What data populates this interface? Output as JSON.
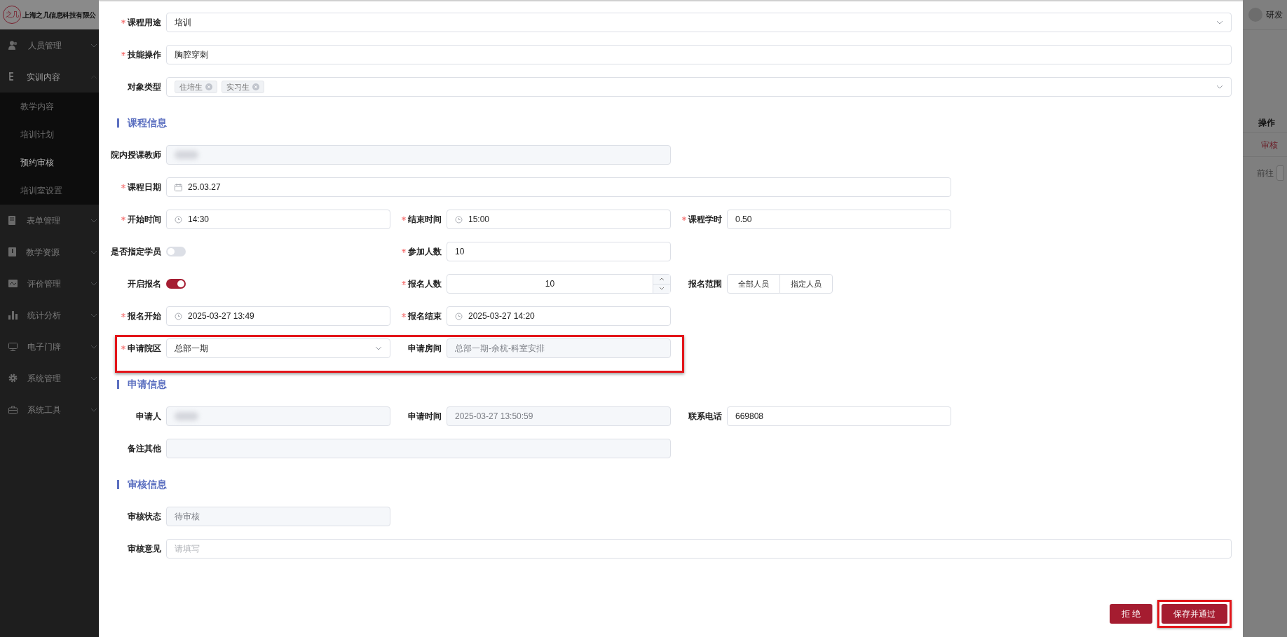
{
  "sidebar": {
    "logo_text": "之几",
    "company": "上海之几信息科技有限公",
    "items": [
      {
        "label": "人员管理",
        "expanded": false
      },
      {
        "label": "实训内容",
        "expanded": true,
        "children": [
          {
            "label": "教学内容",
            "selected": false
          },
          {
            "label": "培训计划",
            "selected": false
          },
          {
            "label": "预约审核",
            "selected": true
          },
          {
            "label": "培训室设置",
            "selected": false
          }
        ]
      },
      {
        "label": "表单管理",
        "expanded": false
      },
      {
        "label": "教学资源",
        "expanded": false
      },
      {
        "label": "评价管理",
        "expanded": false
      },
      {
        "label": "统计分析",
        "expanded": false
      },
      {
        "label": "电子门牌",
        "expanded": false
      },
      {
        "label": "系统管理",
        "expanded": false
      },
      {
        "label": "系统工具",
        "expanded": false
      }
    ]
  },
  "background_page": {
    "user_name": "研发",
    "column_header": "操作",
    "row_action": "审核",
    "pagination_label": "前往"
  },
  "sections": [
    {
      "rows": [
        {
          "kind": "full",
          "fields": [
            {
              "label": "课程用途",
              "required": true,
              "kind": "select",
              "value": "培训"
            }
          ]
        },
        {
          "kind": "full",
          "fields": [
            {
              "label": "技能操作",
              "required": true,
              "kind": "text",
              "value": "胸腔穿刺"
            }
          ]
        },
        {
          "kind": "full",
          "fields": [
            {
              "label": "对象类型",
              "required": false,
              "kind": "tags",
              "tags": [
                "住培生",
                "实习生"
              ]
            }
          ]
        }
      ]
    },
    {
      "title": "课程信息",
      "rows": [
        {
          "kind": "double",
          "fields": [
            {
              "label": "院内授课教师",
              "required": false,
              "kind": "blurred"
            }
          ]
        },
        {
          "kind": "triple",
          "fields": [
            {
              "label": "课程日期",
              "required": true,
              "kind": "date",
              "value": "25.03.27"
            }
          ]
        },
        {
          "kind": "columns",
          "fields": [
            {
              "label": "开始时间",
              "required": true,
              "kind": "time",
              "value": "14:30"
            },
            {
              "label": "结束时间",
              "required": true,
              "kind": "time",
              "value": "15:00"
            },
            {
              "label": "课程学时",
              "required": true,
              "kind": "text",
              "value": "0.50"
            }
          ]
        },
        {
          "kind": "columns",
          "fields": [
            {
              "label": "是否指定学员",
              "required": false,
              "kind": "toggle",
              "on": false
            },
            {
              "label": "参加人数",
              "required": true,
              "kind": "text",
              "value": "10"
            }
          ]
        },
        {
          "kind": "columns",
          "fields": [
            {
              "label": "开启报名",
              "required": false,
              "kind": "toggle",
              "on": true
            },
            {
              "label": "报名人数",
              "required": true,
              "kind": "number",
              "value": "10"
            },
            {
              "label": "报名范围",
              "required": false,
              "kind": "segmented",
              "options": [
                {
                  "label": "全部人员",
                  "selected": false
                },
                {
                  "label": "指定人员",
                  "selected": false
                }
              ]
            }
          ]
        },
        {
          "kind": "columns",
          "fields": [
            {
              "label": "报名开始",
              "required": true,
              "kind": "time",
              "value": "2025-03-27 13:49"
            },
            {
              "label": "报名结束",
              "required": true,
              "kind": "time",
              "value": "2025-03-27 14:20"
            }
          ]
        },
        {
          "kind": "columns",
          "highlighted": true,
          "fields": [
            {
              "label": "申请院区",
              "required": true,
              "kind": "select",
              "value": "总部一期"
            },
            {
              "label": "申请房间",
              "required": false,
              "kind": "readonly",
              "value": "总部一期-余杭-科室安排"
            }
          ]
        }
      ]
    },
    {
      "title": "申请信息",
      "rows": [
        {
          "kind": "columns",
          "fields": [
            {
              "label": "申请人",
              "required": false,
              "kind": "blurred"
            },
            {
              "label": "申请时间",
              "required": false,
              "kind": "readonly",
              "value": "2025-03-27 13:50:59"
            },
            {
              "label": "联系电话",
              "required": false,
              "kind": "text",
              "value": "669808"
            }
          ]
        },
        {
          "kind": "double",
          "fields": [
            {
              "label": "备注其他",
              "required": false,
              "kind": "readonly"
            }
          ]
        }
      ]
    },
    {
      "title": "审核信息",
      "rows": [
        {
          "kind": "columns",
          "fields": [
            {
              "label": "审核状态",
              "required": false,
              "kind": "readonly",
              "value": "待审核"
            }
          ]
        },
        {
          "kind": "full",
          "fields": [
            {
              "label": "审核意见",
              "required": false,
              "kind": "text",
              "placeholder": "请填写"
            }
          ]
        }
      ]
    }
  ],
  "buttons": [
    {
      "label": "拒 绝",
      "highlighted": false
    },
    {
      "label": "保存并通过",
      "highlighted": true
    }
  ]
}
